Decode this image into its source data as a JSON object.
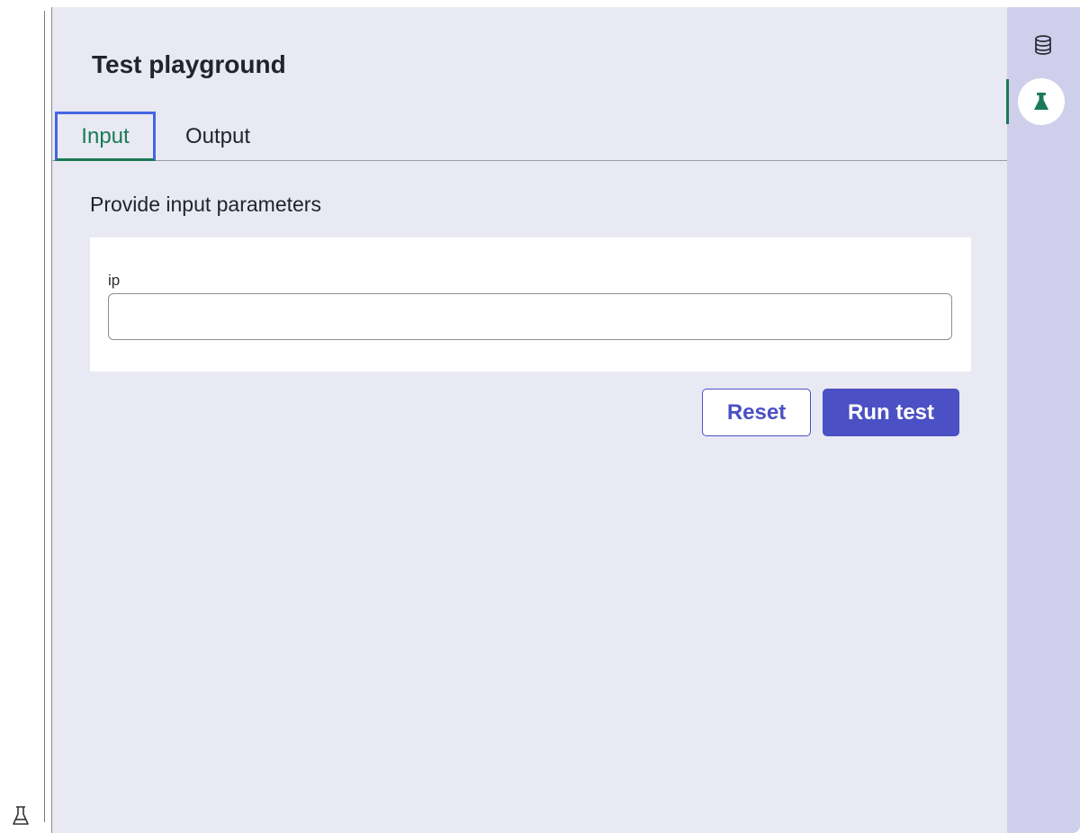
{
  "panel": {
    "title": "Test playground",
    "tabs": [
      {
        "label": "Input",
        "active": true
      },
      {
        "label": "Output",
        "active": false
      }
    ],
    "section_heading": "Provide input parameters",
    "form": {
      "fields": [
        {
          "label": "ip",
          "value": "",
          "placeholder": ""
        }
      ]
    },
    "actions": {
      "reset_label": "Reset",
      "run_label": "Run test"
    }
  },
  "rail": {
    "items": [
      {
        "icon": "database-icon",
        "active": false
      },
      {
        "icon": "flask-icon",
        "active": true
      }
    ]
  },
  "gutter": {
    "icon": "flask-outline-icon"
  },
  "colors": {
    "accent": "#4b50c4",
    "active_tab": "#1b7a55",
    "focus_border": "#4466e0",
    "panel_bg": "#e9e9f3",
    "rail_bg": "#cfcfec"
  }
}
